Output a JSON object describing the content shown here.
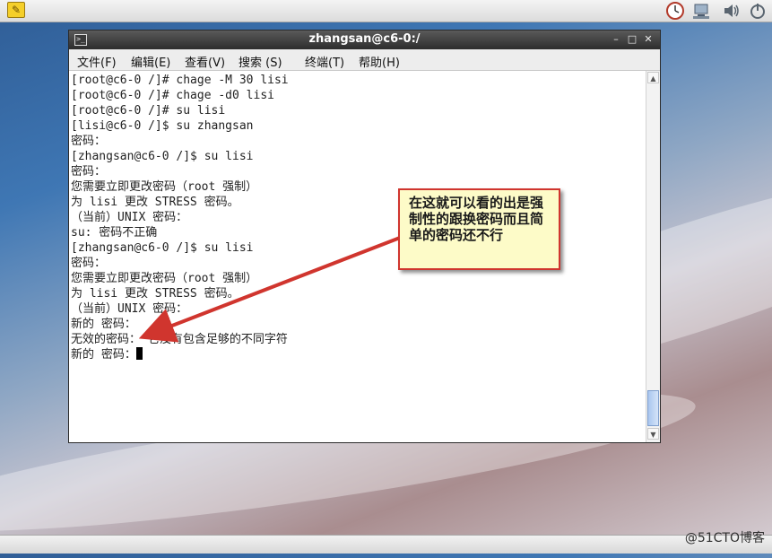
{
  "window": {
    "title": "zhangsan@c6-0:/",
    "minimize_glyph": "–",
    "maximize_glyph": "□",
    "close_glyph": "✕"
  },
  "menu": {
    "items": [
      {
        "label": "文件(F)"
      },
      {
        "label": "编辑(E)"
      },
      {
        "label": "查看(V)"
      },
      {
        "label": "搜索 (S)"
      },
      {
        "label": "终端(T)"
      },
      {
        "label": "帮助(H)"
      }
    ]
  },
  "terminal": {
    "lines": [
      "[root@c6-0 /]# chage -M 30 lisi",
      "[root@c6-0 /]# chage -d0 lisi",
      "[root@c6-0 /]# su lisi",
      "[lisi@c6-0 /]$ su zhangsan",
      "密码：",
      "[zhangsan@c6-0 /]$ su lisi",
      "密码：",
      "您需要立即更改密码（root 强制）",
      "为 lisi 更改 STRESS 密码。",
      "（当前）UNIX 密码：",
      "su: 密码不正确",
      "[zhangsan@c6-0 /]$ su lisi",
      "密码：",
      "您需要立即更改密码（root 强制）",
      "为 lisi 更改 STRESS 密码。",
      "（当前）UNIX 密码：",
      "新的 密码：",
      "无效的密码： 它没有包含足够的不同字符",
      "新的 密码："
    ]
  },
  "callout": {
    "text": "在这就可以看的出是强制性的跟换密码而且简单的密码还不行"
  },
  "watermark": {
    "text": "@51CTO博客"
  },
  "icons": {
    "notes": "notes-icon",
    "clock": "clock-icon",
    "network": "network-icon",
    "volume": "volume-icon",
    "power": "power-icon"
  },
  "colors": {
    "callout_border": "#d0352e",
    "callout_fill": "#fdfbc8",
    "arrow": "#d0352e"
  }
}
